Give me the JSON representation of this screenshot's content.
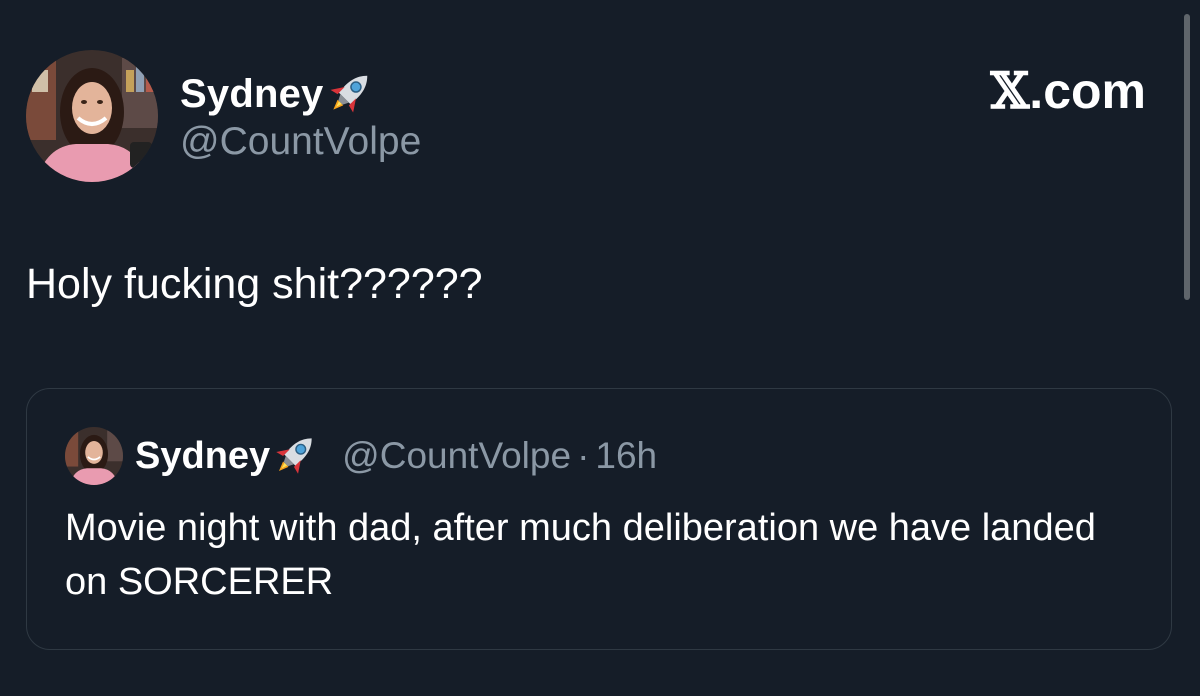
{
  "site": {
    "label_suffix": ".com",
    "logo_icon": "x-logo-icon"
  },
  "author": {
    "name": "Sydney",
    "name_emoji": "rocket-icon",
    "handle": "@CountVolpe"
  },
  "tweet": {
    "text": "Holy fucking shit??????"
  },
  "quoted_tweet": {
    "name": "Sydney",
    "name_emoji": "rocket-icon",
    "handle": "@CountVolpe",
    "separator": "·",
    "time": "16h",
    "text": "Movie night with dad, after much deliberation we have landed on SORCERER"
  },
  "colors": {
    "background": "#151d28",
    "primary_text": "#ffffff",
    "secondary_text": "#8b98a5",
    "card_border": "#2f3943"
  }
}
